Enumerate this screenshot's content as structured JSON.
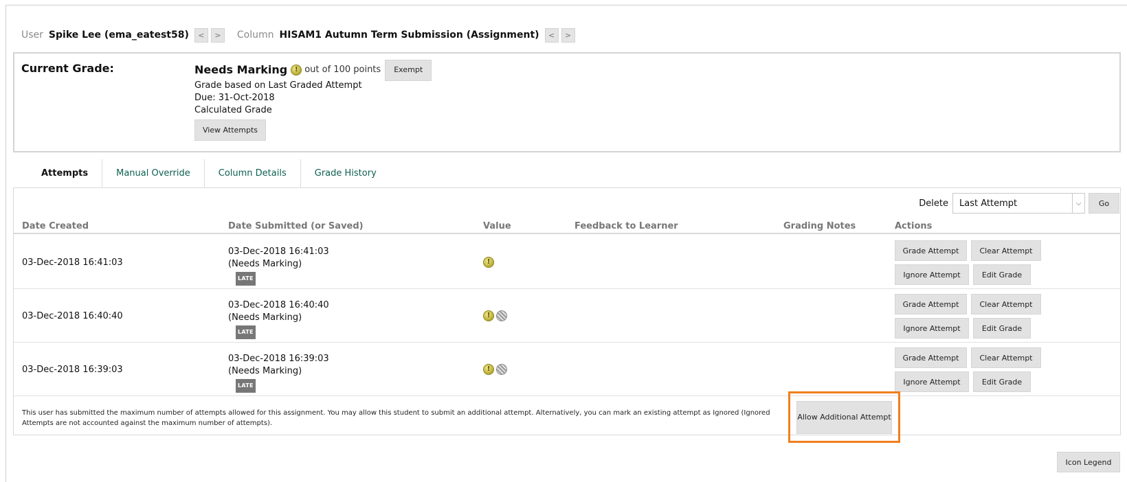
{
  "nav": {
    "user_label": "User",
    "user_value": "Spike Lee (ema_eatest58)",
    "column_label": "Column",
    "column_value": "HISAM1 Autumn Term Submission (Assignment)",
    "prev_glyph": "<",
    "next_glyph": ">"
  },
  "current_grade": {
    "title": "Current Grade:",
    "status": "Needs Marking",
    "out_of": "out of 100 points",
    "exempt_label": "Exempt",
    "basis": "Grade based on Last Graded Attempt",
    "due": "Due: 31-Oct-2018",
    "calculated": "Calculated Grade",
    "view_attempts_label": "View Attempts"
  },
  "tabs": [
    {
      "label": "Attempts",
      "active": true
    },
    {
      "label": "Manual Override",
      "active": false
    },
    {
      "label": "Column Details",
      "active": false
    },
    {
      "label": "Grade History",
      "active": false
    }
  ],
  "delete_control": {
    "label": "Delete",
    "selected": "Last Attempt",
    "go_label": "Go"
  },
  "columns": [
    "Date Created",
    "Date Submitted (or Saved)",
    "Value",
    "Feedback to Learner",
    "Grading Notes",
    "Actions"
  ],
  "attempts": [
    {
      "date_created": "03-Dec-2018 16:41:03",
      "date_submitted": "03-Dec-2018 16:41:03",
      "status": "(Needs Marking)",
      "badge": "LATE",
      "icons": [
        "needs-marking-icon"
      ],
      "actions": [
        "Grade Attempt",
        "Clear Attempt",
        "Ignore Attempt",
        "Edit Grade"
      ]
    },
    {
      "date_created": "03-Dec-2018 16:40:40",
      "date_submitted": "03-Dec-2018 16:40:40",
      "status": "(Needs Marking)",
      "badge": "LATE",
      "icons": [
        "needs-marking-icon",
        "ignored-attempt-icon"
      ],
      "actions": [
        "Grade Attempt",
        "Clear Attempt",
        "Ignore Attempt",
        "Edit Grade"
      ]
    },
    {
      "date_created": "03-Dec-2018 16:39:03",
      "date_submitted": "03-Dec-2018 16:39:03",
      "status": "(Needs Marking)",
      "badge": "LATE",
      "icons": [
        "needs-marking-icon",
        "ignored-attempt-icon"
      ],
      "actions": [
        "Grade Attempt",
        "Clear Attempt",
        "Ignore Attempt",
        "Edit Grade"
      ]
    }
  ],
  "notice": "This user has submitted the maximum number of attempts allowed for this assignment. You may allow this student to submit an additional attempt. Alternatively, you can mark an existing attempt as Ignored (Ignored Attempts are not accounted against the maximum number of attempts).",
  "allow_additional_label": "Allow Additional Attempt",
  "icon_legend_label": "Icon Legend",
  "colors": {
    "link": "#0e6052",
    "highlight": "#f07f1b",
    "button_bg": "#e2e2e2"
  }
}
